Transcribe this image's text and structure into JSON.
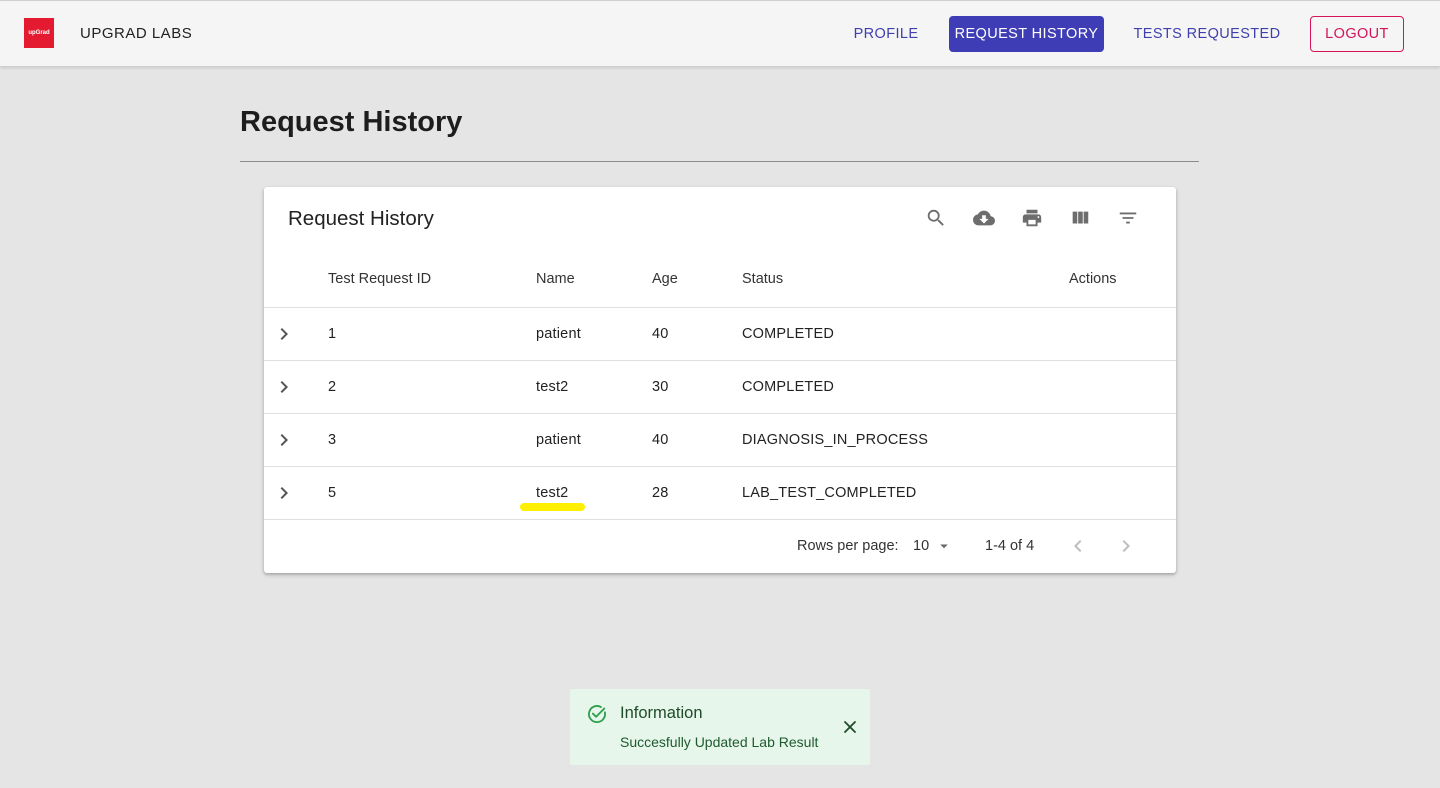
{
  "appbar": {
    "logo_text": "upGrad",
    "brand": "UPGRAD LABS",
    "nav": {
      "profile": "PROFILE",
      "request_history": "REQUEST HISTORY",
      "tests_requested": "TESTS REQUESTED",
      "logout": "LOGOUT"
    },
    "colors": {
      "accent": "#3f3db5",
      "logout": "#d4135a"
    }
  },
  "page": {
    "title": "Request History"
  },
  "table": {
    "title": "Request History",
    "toolbar_icons": [
      "search-icon",
      "download-icon",
      "print-icon",
      "columns-icon",
      "filter-icon"
    ],
    "columns": [
      "Test Request ID",
      "Name",
      "Age",
      "Status",
      "Actions"
    ],
    "rows": [
      {
        "id": "1",
        "name": "patient",
        "age": "40",
        "status": "COMPLETED"
      },
      {
        "id": "2",
        "name": "test2",
        "age": "30",
        "status": "COMPLETED"
      },
      {
        "id": "3",
        "name": "patient",
        "age": "40",
        "status": "DIAGNOSIS_IN_PROCESS"
      },
      {
        "id": "5",
        "name": "test2",
        "age": "28",
        "status": "LAB_TEST_COMPLETED"
      }
    ],
    "pagination": {
      "rows_per_page_label": "Rows per page:",
      "rows_per_page": "10",
      "range": "1-4 of 4"
    }
  },
  "toast": {
    "title": "Information",
    "message": "Succesfully Updated Lab Result",
    "color": "#2e9e4f"
  }
}
